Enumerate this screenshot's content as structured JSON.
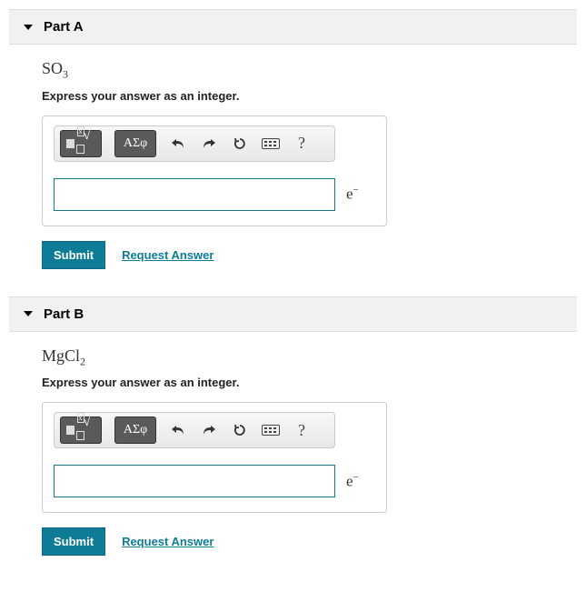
{
  "parts": [
    {
      "title": "Part A",
      "formula": {
        "base": "SO",
        "sub": "3"
      },
      "instruction": "Express your answer as an integer.",
      "toolbar": {
        "templates_label": "templates",
        "greek_label": "ΑΣφ",
        "undo": "↶",
        "redo": "↷",
        "reset": "↻",
        "keyboard": "⌨",
        "help": "?"
      },
      "answer_value": "",
      "unit": {
        "base": "e",
        "sup": "−"
      },
      "submit_label": "Submit",
      "request_label": "Request Answer"
    },
    {
      "title": "Part B",
      "formula": {
        "base": "MgCl",
        "sub": "2"
      },
      "instruction": "Express your answer as an integer.",
      "toolbar": {
        "templates_label": "templates",
        "greek_label": "ΑΣφ",
        "undo": "↶",
        "redo": "↷",
        "reset": "↻",
        "keyboard": "⌨",
        "help": "?"
      },
      "answer_value": "",
      "unit": {
        "base": "e",
        "sup": "−"
      },
      "submit_label": "Submit",
      "request_label": "Request Answer"
    }
  ]
}
